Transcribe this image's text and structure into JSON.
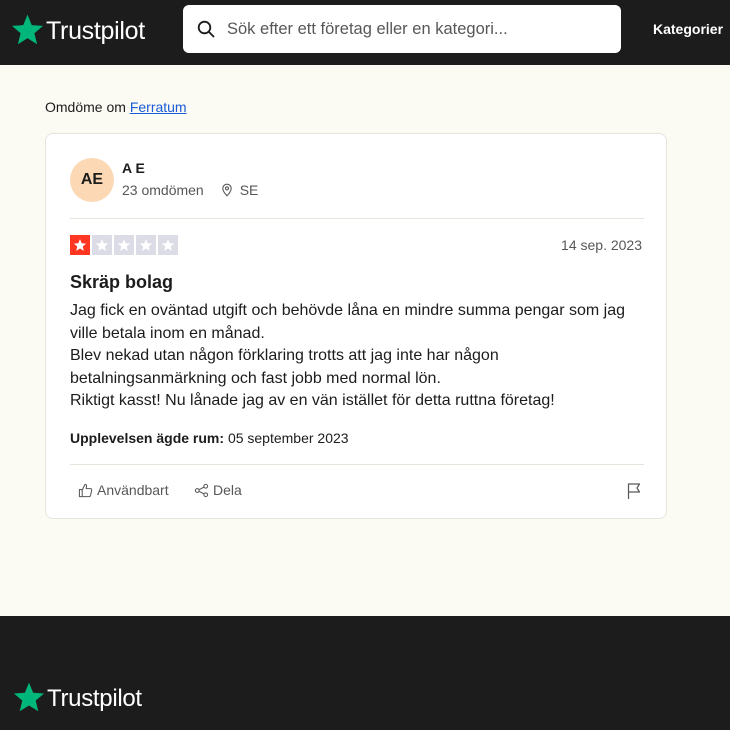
{
  "brand": {
    "name": "Trustpilot",
    "star_color": "#00b67a"
  },
  "header": {
    "search_placeholder": "Sök efter ett företag eller en kategori...",
    "categories_label": "Kategorier"
  },
  "breadcrumb": {
    "prefix": "Omdöme om",
    "company": "Ferratum"
  },
  "review": {
    "reviewer": {
      "initials": "AE",
      "name": "A E",
      "reviews_count": "23 omdömen",
      "country": "SE"
    },
    "rating": 1,
    "rating_max": 5,
    "rating_color": "#ff3722",
    "date": "14 sep. 2023",
    "title": "Skräp bolag",
    "body": [
      "Jag fick en oväntad utgift och behövde låna en mindre summa pengar som jag ville betala inom en månad.",
      "Blev nekad utan någon förklaring trotts att jag inte har någon betalningsanmärkning och fast jobb med normal lön.",
      "Riktigt kasst! Nu lånade jag av en vän istället för detta ruttna företag!"
    ],
    "experience_label": "Upplevelsen ägde rum:",
    "experience_date": "05 september 2023",
    "actions": {
      "useful": "Användbart",
      "share": "Dela"
    }
  },
  "icons": {
    "search": "search-icon",
    "pin": "location-pin-icon",
    "thumb": "thumbs-up-icon",
    "share": "share-icon",
    "flag": "flag-icon"
  }
}
